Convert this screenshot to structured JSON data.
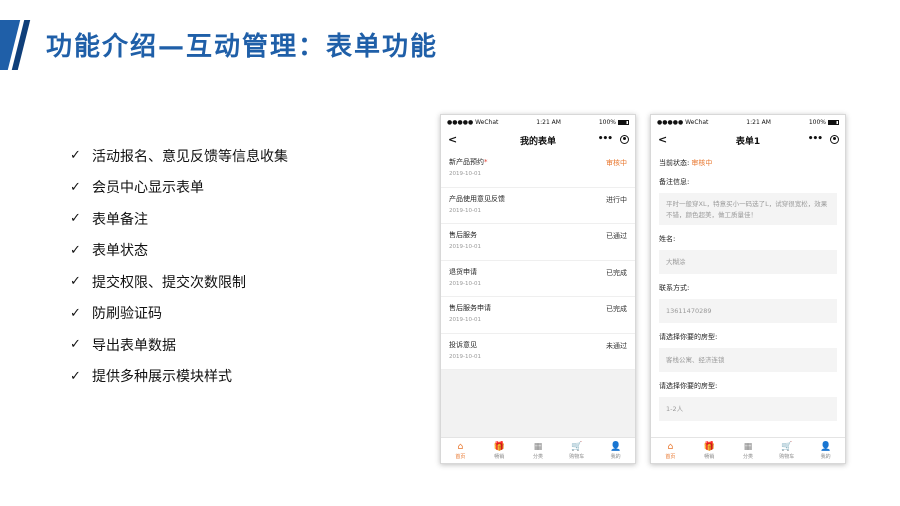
{
  "slide": {
    "title": "功能介绍—互动管理：表单功能"
  },
  "features": [
    "活动报名、意见反馈等信息收集",
    "会员中心显示表单",
    "表单备注",
    "表单状态",
    "提交权限、提交次数限制",
    "防刷验证码",
    "导出表单数据",
    "提供多种展示模块样式"
  ],
  "check_glyph": "✓",
  "statusbar": {
    "carrier": "●●●●● WeChat",
    "time": "1:21 AM",
    "battery": "100%"
  },
  "phone1": {
    "nav_title": "我的表单",
    "rows": [
      {
        "name": "新产品预约",
        "required": "*",
        "date": "2019-10-01",
        "status": "审核中",
        "pending": true
      },
      {
        "name": "产品使用意见反馈",
        "required": "",
        "date": "2019-10-01",
        "status": "进行中",
        "pending": false
      },
      {
        "name": "售后服务",
        "required": "",
        "date": "2019-10-01",
        "status": "已通过",
        "pending": false
      },
      {
        "name": "退货申请",
        "required": "",
        "date": "2019-10-01",
        "status": "已完成",
        "pending": false
      },
      {
        "name": "售后服务申请",
        "required": "",
        "date": "2019-10-01",
        "status": "已完成",
        "pending": false
      },
      {
        "name": "投诉意见",
        "required": "",
        "date": "2019-10-01",
        "status": "未通过",
        "pending": false
      }
    ]
  },
  "phone2": {
    "nav_title": "表单1",
    "status_label": "当前状态:",
    "status_value": "审核中",
    "fields": [
      {
        "label": "备注信息:",
        "value": "平时一般穿XL，特意买小一码选了L，试穿很宽松，效果不错，颜色超美，做工质量佳！",
        "multi": true
      },
      {
        "label": "姓名:",
        "value": "大糊涂",
        "multi": false
      },
      {
        "label": "联系方式:",
        "value": "13611470289",
        "multi": false
      },
      {
        "label": "请选择你要的房型:",
        "value": "客栈公寓、经济连锁",
        "multi": false
      },
      {
        "label": "请选择你要的房型:",
        "value": "1-2人",
        "multi": false
      }
    ]
  },
  "tabbar": [
    {
      "label": "首页",
      "icon": "home-icon",
      "glyph": "⌂",
      "active": true
    },
    {
      "label": "畅销",
      "icon": "gift-icon",
      "glyph": "🎁",
      "active": false
    },
    {
      "label": "分类",
      "icon": "grid-icon",
      "glyph": "▦",
      "active": false
    },
    {
      "label": "购物车",
      "icon": "cart-icon",
      "glyph": "🛒",
      "active": false
    },
    {
      "label": "我的",
      "icon": "user-icon",
      "glyph": "👤",
      "active": false
    }
  ],
  "colors": {
    "brand_blue": "#1f5fa8",
    "accent_orange": "#e8762d",
    "required_red": "#e23b2e"
  }
}
